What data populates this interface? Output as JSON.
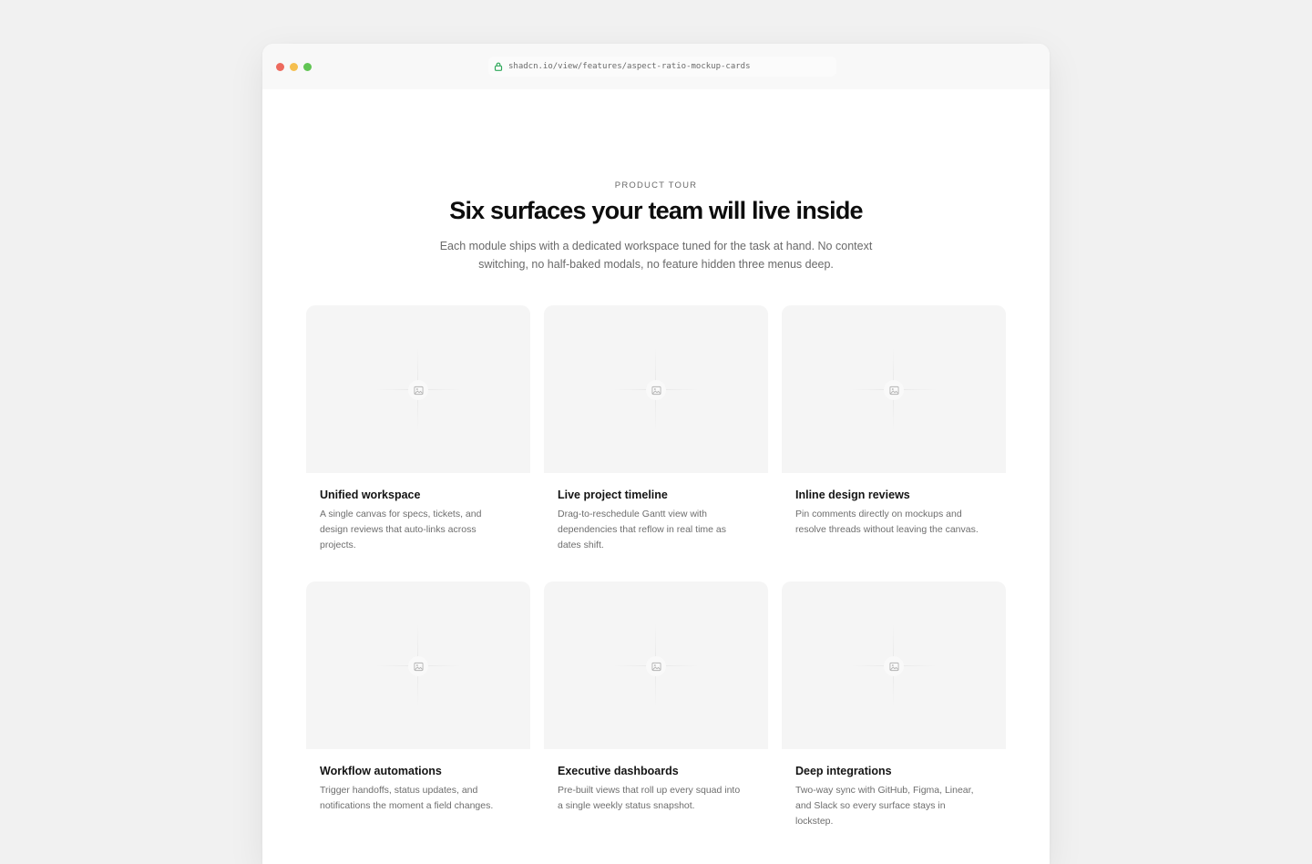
{
  "browser": {
    "url": "shadcn.io/view/features/aspect-ratio-mockup-cards"
  },
  "header": {
    "eyebrow": "PRODUCT TOUR",
    "title": "Six surfaces your team will live inside",
    "subtitle": "Each module ships with a dedicated workspace tuned for the task at hand. No context switching, no half-baked modals, no feature hidden three menus deep."
  },
  "cards": [
    {
      "title": "Unified workspace",
      "description": "A single canvas for specs, tickets, and design reviews that auto-links across projects.",
      "icon": "image-placeholder-icon"
    },
    {
      "title": "Live project timeline",
      "description": "Drag-to-reschedule Gantt view with dependencies that reflow in real time as dates shift.",
      "icon": "image-placeholder-icon"
    },
    {
      "title": "Inline design reviews",
      "description": "Pin comments directly on mockups and resolve threads without leaving the canvas.",
      "icon": "image-placeholder-icon"
    },
    {
      "title": "Workflow automations",
      "description": "Trigger handoffs, status updates, and notifications the moment a field changes.",
      "icon": "image-placeholder-icon"
    },
    {
      "title": "Executive dashboards",
      "description": "Pre-built views that roll up every squad into a single weekly status snapshot.",
      "icon": "image-placeholder-icon"
    },
    {
      "title": "Deep integrations",
      "description": "Two-way sync with GitHub, Figma, Linear, and Slack so every surface stays in lockstep.",
      "icon": "image-placeholder-icon"
    }
  ],
  "colors": {
    "traffic_red": "#ed6a5e",
    "traffic_yellow": "#f5bf4f",
    "traffic_green": "#61c554",
    "lock_green": "#2fa85a"
  }
}
